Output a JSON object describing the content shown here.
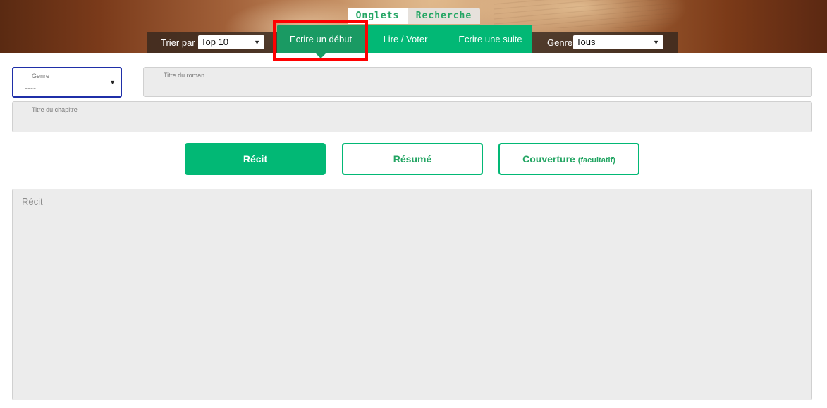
{
  "header": {
    "top_tabs": [
      {
        "label": "Onglets",
        "active": true
      },
      {
        "label": "Recherche",
        "active": false
      }
    ],
    "sort": {
      "label": "Trier par",
      "selected": "Top 10"
    },
    "genre_filter": {
      "label": "Genre",
      "selected": "Tous"
    },
    "nav_tabs": [
      {
        "label": "Ecrire un début",
        "active": true
      },
      {
        "label": "Lire / Voter",
        "active": false
      },
      {
        "label": "Ecrire une suite",
        "active": false
      }
    ]
  },
  "form": {
    "genre": {
      "label": "Genre",
      "value": "----"
    },
    "novel_title": {
      "label": "Titre du roman",
      "value": ""
    },
    "chapter_title": {
      "label": "Titre du chapitre",
      "value": ""
    },
    "buttons": {
      "recit": "Récit",
      "resume": "Résumé",
      "couverture": "Couverture",
      "couverture_note": "(facultatif)"
    },
    "recit_placeholder": "Récit"
  },
  "colors": {
    "accent": "#02b875",
    "accent_dark": "#1a9a63",
    "highlight_box": "#ff0000",
    "focus_border": "#1f2fa8"
  },
  "icons": [
    "dropdown-arrow-icon"
  ]
}
